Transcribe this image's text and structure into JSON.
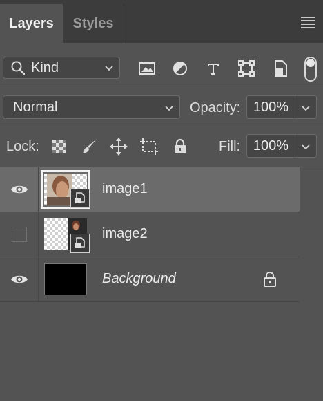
{
  "tabs": [
    {
      "label": "Layers",
      "active": true
    },
    {
      "label": "Styles",
      "active": false
    }
  ],
  "filter": {
    "kind_label": "Kind",
    "icons": [
      "image-filter-icon",
      "adjustment-filter-icon",
      "type-filter-icon",
      "shape-filter-icon",
      "smart-object-filter-icon"
    ]
  },
  "blend": {
    "mode": "Normal",
    "opacity_label": "Opacity:",
    "opacity_value": "100%"
  },
  "lock": {
    "label": "Lock:",
    "fill_label": "Fill:",
    "fill_value": "100%"
  },
  "layers": [
    {
      "name": "image1",
      "visible": true,
      "selected": true,
      "smart_object": true
    },
    {
      "name": "image2",
      "visible": false,
      "selected": false,
      "smart_object": true
    },
    {
      "name": "Background",
      "visible": true,
      "selected": false,
      "locked": true
    }
  ],
  "colors": {
    "panel_bg": "#535353",
    "tabbar_bg": "#3c3c3c",
    "selected_row": "#6b6b6b",
    "text": "#e6e6e6"
  }
}
